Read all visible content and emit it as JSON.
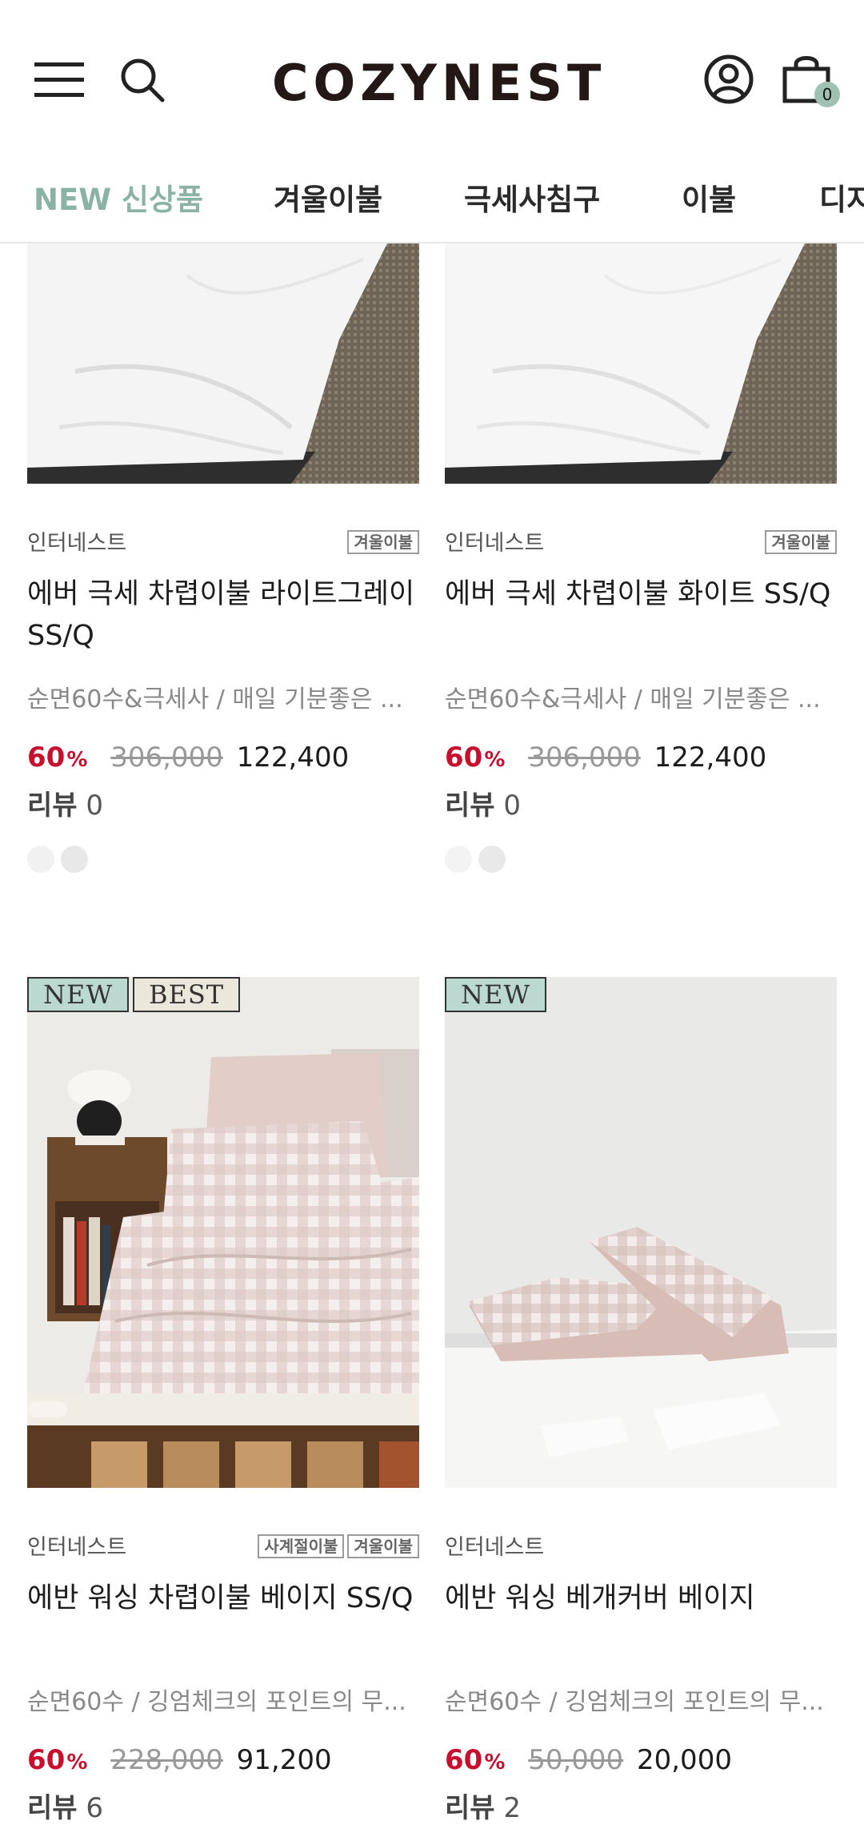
{
  "header": {
    "logo": "COZYNEST",
    "cart_count": "0"
  },
  "nav": {
    "categories": [
      {
        "label": "NEW 신상품"
      },
      {
        "label": "겨울이불"
      },
      {
        "label": "극세사침구"
      },
      {
        "label": "이불"
      },
      {
        "label": "디지"
      }
    ]
  },
  "products": [
    {
      "brand": "인터네스트",
      "tags": [
        "겨울이불"
      ],
      "name": "에버 극세 차렵이불 라이트그레이 SS/Q",
      "desc": "순면60수&극세사 / 매일 기분좋은 ...",
      "discount": "60",
      "discount_unit": "%",
      "original_price": "306,000",
      "price": "122,400",
      "review_label": "리뷰",
      "review_count": "0",
      "swatch_colors": [
        "#f1f1f1",
        "#e8e8e8"
      ]
    },
    {
      "brand": "인터네스트",
      "tags": [
        "겨울이불"
      ],
      "name": "에버 극세 차렵이불 화이트 SS/Q",
      "desc": "순면60수&극세사 / 매일 기분좋은 ...",
      "discount": "60",
      "discount_unit": "%",
      "original_price": "306,000",
      "price": "122,400",
      "review_label": "리뷰",
      "review_count": "0",
      "swatch_colors": [
        "#f3f3f3",
        "#e9e9e9"
      ]
    },
    {
      "badges": [
        "NEW",
        "BEST"
      ],
      "brand": "인터네스트",
      "tags": [
        "사계절이불",
        "겨울이불"
      ],
      "name": "에반 워싱 차렵이불 베이지 SS/Q",
      "desc": "순면60수 / 깅엄체크의 포인트의 무...",
      "discount": "60",
      "discount_unit": "%",
      "original_price": "228,000",
      "price": "91,200",
      "review_label": "리뷰",
      "review_count": "6"
    },
    {
      "badges": [
        "NEW"
      ],
      "brand": "인터네스트",
      "tags": [],
      "name": "에반 워싱 베개커버 베이지",
      "desc": "순면60수 / 깅엄체크의 포인트의 무...",
      "discount": "60",
      "discount_unit": "%",
      "original_price": "50,000",
      "price": "20,000",
      "review_label": "리뷰",
      "review_count": "2"
    }
  ]
}
